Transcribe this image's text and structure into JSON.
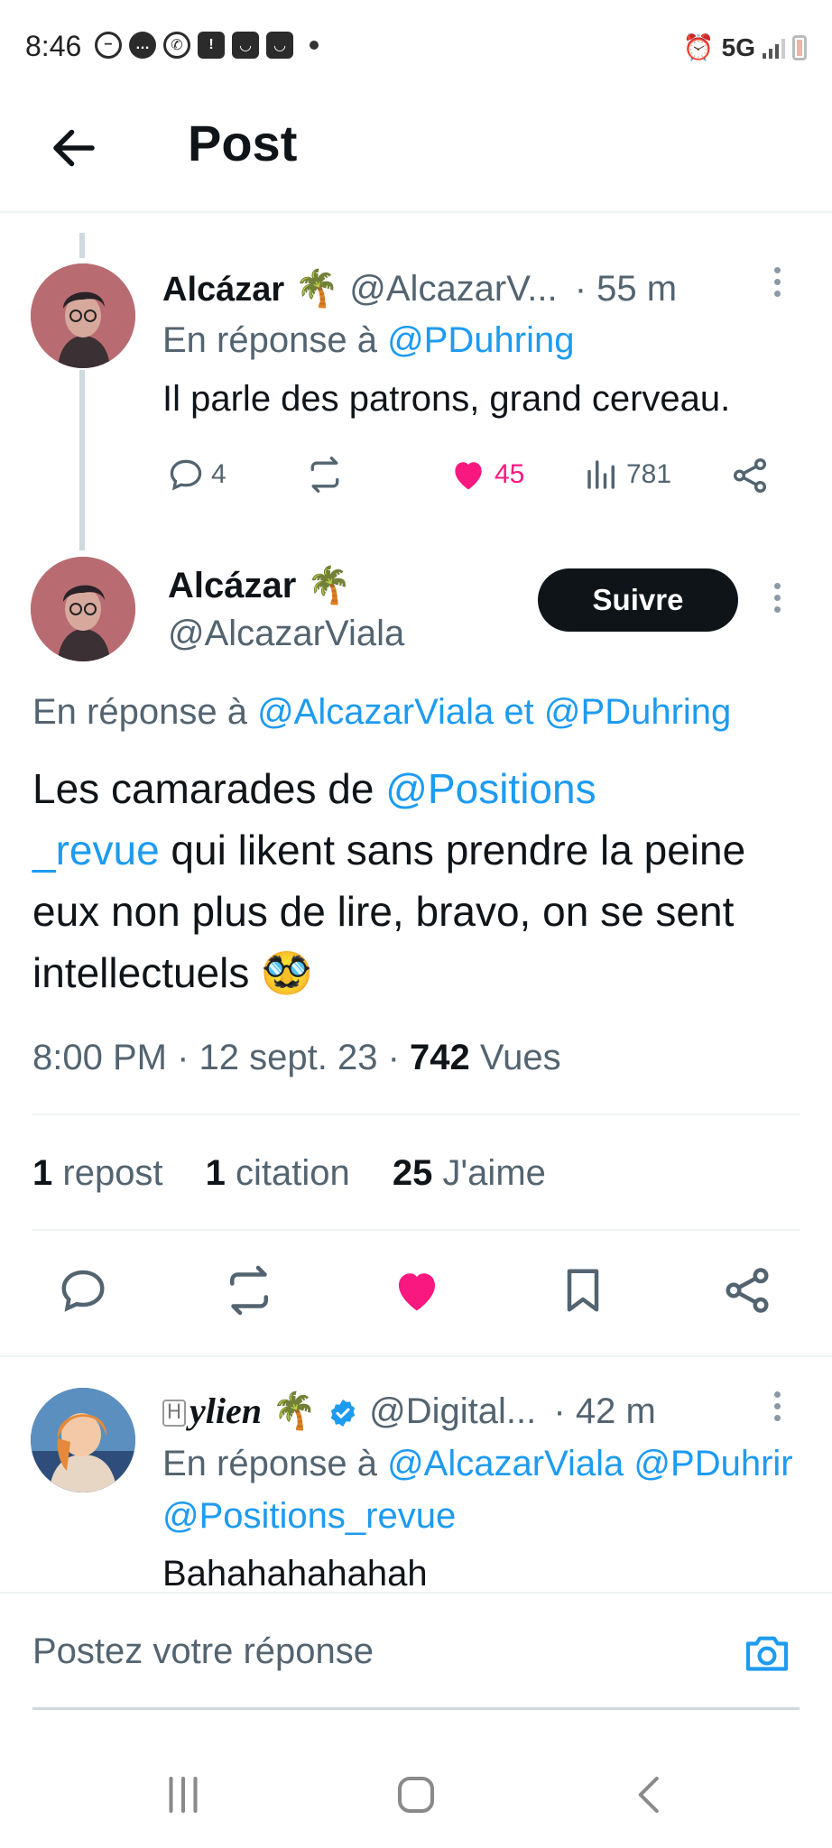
{
  "status_bar": {
    "time": "8:46",
    "network": "5G"
  },
  "header": {
    "title": "Post"
  },
  "parent_reply": {
    "display_name": "Alcázar",
    "name_emoji": "🌴",
    "handle": "@AlcazarV...",
    "time": "· 55 m",
    "reply_prefix": "En réponse à",
    "reply_to": "@PDuhring",
    "text": "Il parle des patrons, grand cerveau.",
    "replies": "4",
    "likes": "45",
    "views": "781"
  },
  "main_post": {
    "display_name": "Alcázar",
    "name_emoji": "🌴",
    "handle": "@AlcazarViala",
    "follow_label": "Suivre",
    "reply_prefix": "En réponse à",
    "reply_to_1": "@AlcazarViala",
    "reply_and": "et",
    "reply_to_2": "@PDuhring",
    "body_pre": "Les camarades de ",
    "body_mention_1": "@Positions",
    "body_mention_2": "_revue",
    "body_post": " qui likent sans prendre la peine eux non plus de lire, bravo, on se sent intellectuels",
    "body_emoji": "🥸",
    "time": "8:00 PM",
    "date": "12 sept. 23",
    "views_count": "742",
    "views_label": "Vues",
    "reposts_count": "1",
    "reposts_label": "repost",
    "quotes_count": "1",
    "quotes_label": "citation",
    "likes_count": "25",
    "likes_label": "J'aime"
  },
  "child_reply": {
    "badge": "H",
    "display_name": "ylien",
    "name_emoji": "🌴",
    "handle": "@Digital...",
    "time": "· 42 m",
    "reply_prefix": "En réponse à",
    "reply_to_1": "@AlcazarViala",
    "reply_to_2": "@PDuhrir",
    "reply_to_3": "@Positions_revue",
    "text": "Bahahahahahah"
  },
  "composer": {
    "placeholder": "Postez votre réponse"
  },
  "colors": {
    "accent": "#1d9bf0",
    "like": "#f91880",
    "muted": "#536471",
    "text": "#0f1419"
  }
}
